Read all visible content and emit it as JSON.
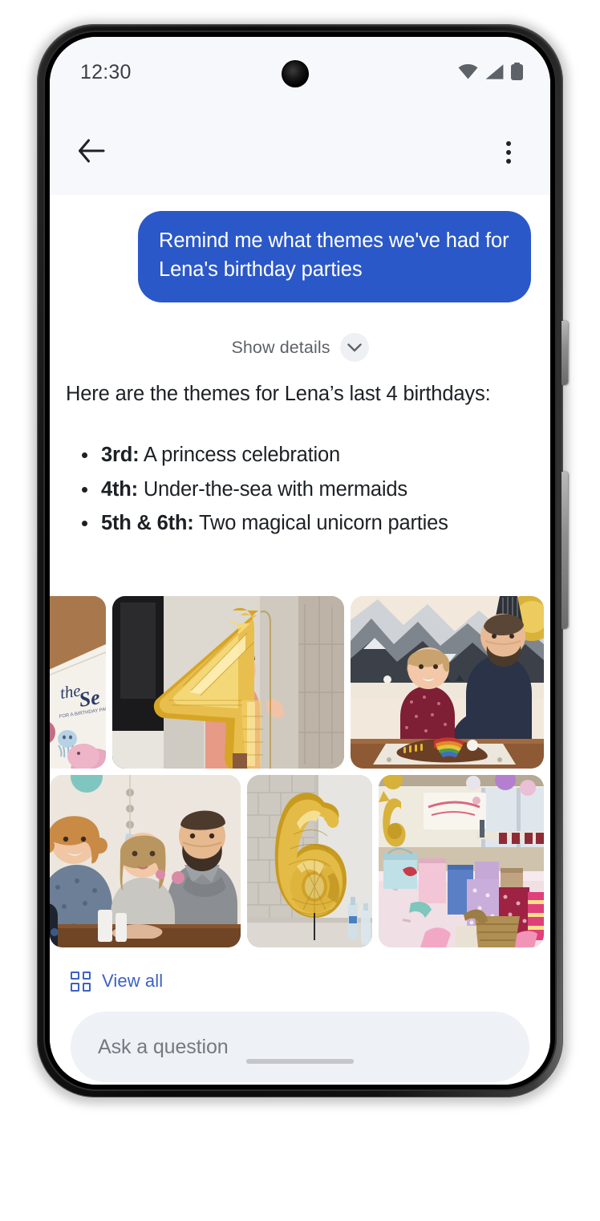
{
  "status_bar": {
    "time": "12:30",
    "icons": [
      "wifi-icon",
      "cellular-signal-icon",
      "battery-icon"
    ]
  },
  "toolbar": {
    "back_icon": "arrow-back-icon",
    "overflow_icon": "more-vert-icon"
  },
  "conversation": {
    "user_message": "Remind me what themes we've had for Lena's birthday parties",
    "show_details": {
      "label": "Show details",
      "icon": "chevron-down-icon"
    },
    "answer": {
      "intro": "Here are the themes for Lena’s last 4 birthdays:",
      "items": [
        {
          "term": "3rd:",
          "detail": "A princess celebration"
        },
        {
          "term": "4th:",
          "detail": "Under-the-sea with mermaids"
        },
        {
          "term": "5th & 6th:",
          "detail": "Two magical unicorn parties"
        }
      ]
    }
  },
  "photo_grid": {
    "rows": [
      [
        {
          "alt": "Under the Sea birthday invitation card on wood table",
          "clipped": true
        },
        {
          "alt": "Girl behind large gold number 4 balloon",
          "clipped": false
        },
        {
          "alt": "Girl and father at table with rainbow cake",
          "clipped": false
        }
      ],
      [
        {
          "alt": "Mother, girl and father posing at table",
          "clipped": false
        },
        {
          "alt": "Large gold number 6 balloon against brick wall",
          "clipped": false
        },
        {
          "alt": "Party hall table covered with wrapped gift bags",
          "clipped": false
        }
      ]
    ],
    "view_all": {
      "label": "View all",
      "icon": "grid-view-icon"
    }
  },
  "composer": {
    "placeholder": "Ask a question"
  },
  "colors": {
    "user_bubble": "#2b58c8",
    "link_blue": "#3b62c4",
    "header_band": "#f6f8fc",
    "composer_bg": "#eef1f6",
    "text_primary": "#1d2024",
    "text_secondary": "#5e6267"
  }
}
